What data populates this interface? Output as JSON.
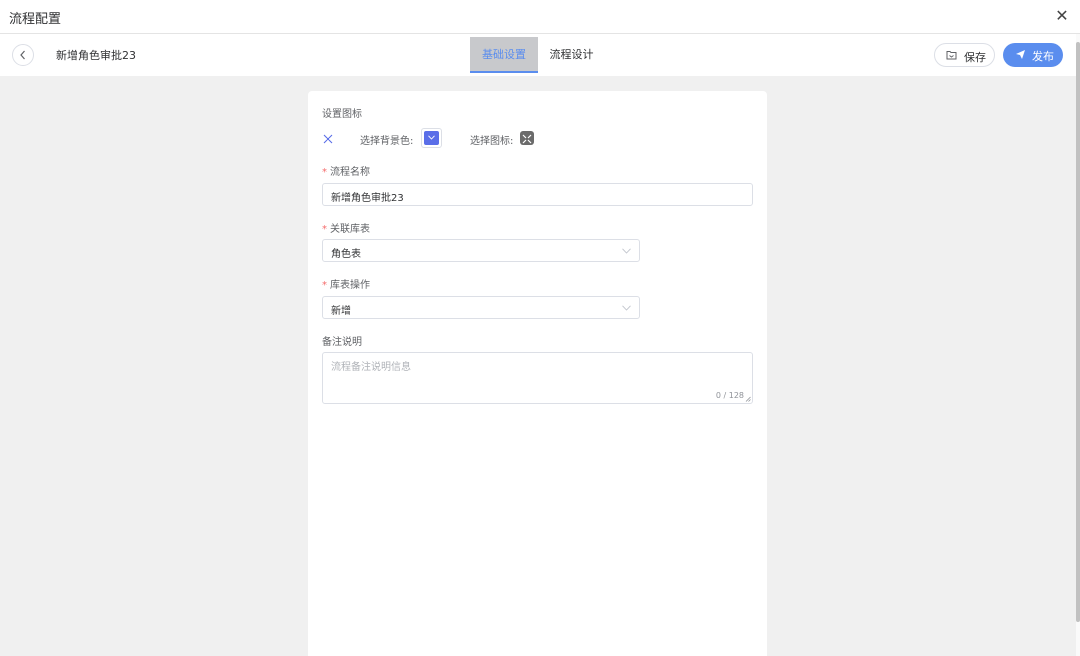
{
  "dialog": {
    "title": "流程配置",
    "close_icon": "close-icon"
  },
  "header": {
    "flow_name": "新增角色审批23",
    "tabs": [
      {
        "label": "基础设置",
        "active": true
      },
      {
        "label": "流程设计",
        "active": false
      }
    ],
    "save_label": "保存",
    "publish_label": "发布"
  },
  "form": {
    "icon_section_label": "设置图标",
    "bg_color_label": "选择背景色:",
    "bg_color": "#5a6ee8",
    "icon_label": "选择图标:",
    "name_label": "流程名称",
    "name_value": "新增角色审批23",
    "table_label": "关联库表",
    "table_value": "角色表",
    "op_label": "库表操作",
    "op_value": "新增",
    "remark_label": "备注说明",
    "remark_placeholder": "流程备注说明信息",
    "remark_count": "0 / 128"
  },
  "colors": {
    "accent": "#5a8dee",
    "required": "#f56c6c"
  }
}
